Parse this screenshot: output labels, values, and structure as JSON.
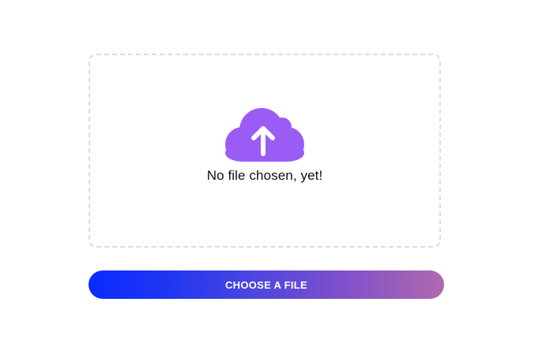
{
  "upload": {
    "status_text": "No file chosen, yet!",
    "icon": "cloud-upload-icon",
    "button_label": "CHOOSE A FILE"
  },
  "colors": {
    "icon": "#9b5cf5",
    "dropzone_border": "#dddddd",
    "button_gradient_start": "#0a2bff",
    "button_gradient_end": "#b06aae",
    "button_text": "#ffffff"
  }
}
